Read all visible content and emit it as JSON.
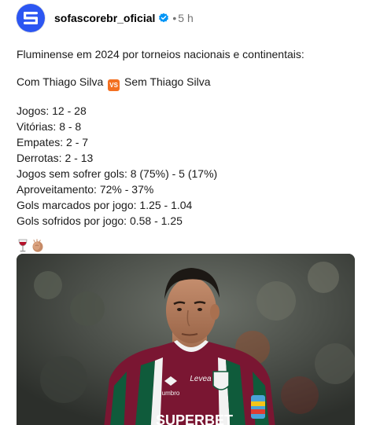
{
  "post": {
    "username": "sofascorebr_oficial",
    "separator": "•",
    "time": "5 h",
    "avatar_icon": "sofascore-logo-icon",
    "verified_icon": "verified-badge-icon",
    "colors": {
      "avatar_bg": "#2c56f2",
      "verified": "#0095f6",
      "vs_badge": "#f37021"
    }
  },
  "caption": {
    "title": "Fluminense em 2024 por torneios nacionais e continentais:",
    "comparison": {
      "left": "Com Thiago Silva",
      "vs_label": "VS",
      "right": "Sem Thiago Silva"
    },
    "stats": [
      "Jogos: 12 - 28",
      "Vitórias: 8 - 8",
      "Empates: 2 - 7",
      "Derrotas: 2 - 13",
      "Jogos sem sofrer gols: 8 (75%) - 5 (17%)",
      "Aproveitamento: 72% - 37%",
      "Gols marcados por jogo: 1.25 - 1.04",
      "Gols sofridos por jogo: 0.58 - 1.25"
    ],
    "emojis": [
      "wine-glass-icon",
      "clapping-hands-icon"
    ]
  },
  "media": {
    "sponsor_text": "SUPERBET",
    "shirt_brand": "Levea",
    "kit_brand": "umbro"
  }
}
